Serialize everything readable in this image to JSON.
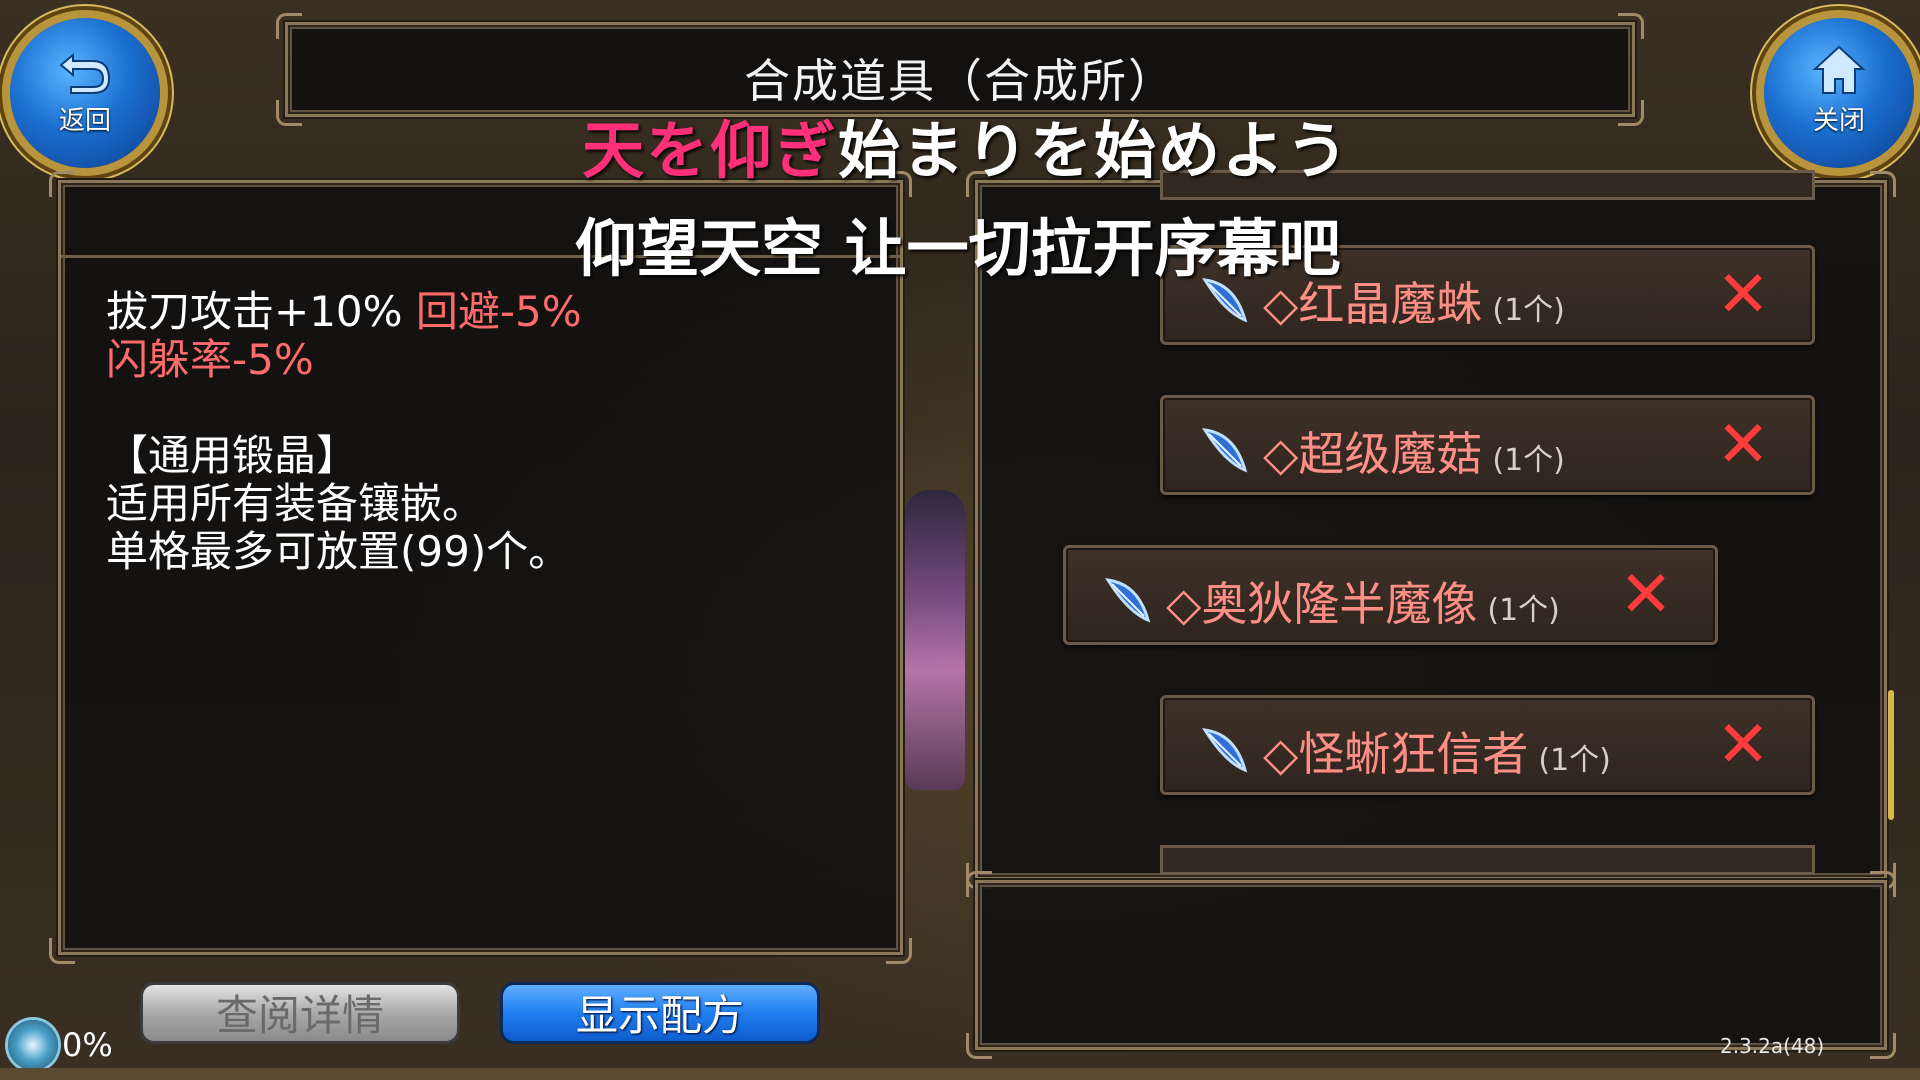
{
  "header": {
    "title": "合成道具（合成所）",
    "back_label": "返回",
    "close_label": "关闭"
  },
  "subtitles": {
    "line1_highlight": "天を仰ぎ",
    "line1_rest": "始まりを始めよう",
    "line2": "仰望天空 让一切拉开序幕吧"
  },
  "description": {
    "line1_white": "拔刀攻击+10%",
    "line1_red": "回避-5%",
    "line2_red": "闪躲率-5%",
    "category": "【通用锻晶】",
    "text1": "适用所有装备镶嵌。",
    "text2": "单格最多可放置(99)个。"
  },
  "buttons": {
    "view_details": "查阅详情",
    "show_recipe": "显示配方"
  },
  "materials": [
    {
      "name": "◇红晶魔蛛",
      "count": "(1个)"
    },
    {
      "name": "◇超级魔菇",
      "count": "(1个)"
    },
    {
      "name": "◇奥狄隆半魔像",
      "count": "(1个)"
    },
    {
      "name": "◇怪蜥狂信者",
      "count": "(1个)"
    }
  ],
  "remove_symbol": "✕",
  "status": {
    "loading_percent": "0%",
    "version": "2.3.2a(48)"
  },
  "colors": {
    "accent_blue": "#1f7ef0",
    "material_name": "#ff8f86",
    "remove_red": "#ff3b3b",
    "frame": "#8a7658",
    "subtitle_pink": "#ff2f7a"
  }
}
